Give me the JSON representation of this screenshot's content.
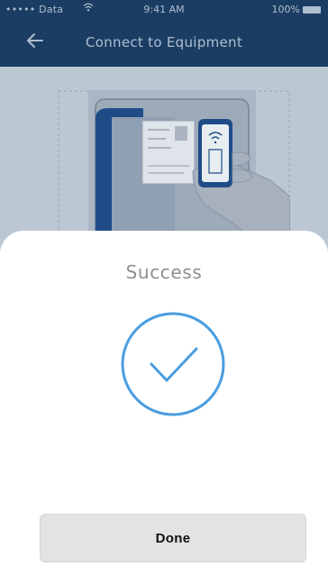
{
  "status_bar": {
    "carrier": "••••• Data",
    "time": "9:41 AM",
    "battery": "100%"
  },
  "nav": {
    "title": "Connect to Equipment",
    "back_icon": "arrow-left-icon"
  },
  "modal": {
    "title": "Success",
    "icon": "checkmark-circle-icon",
    "done_label": "Done"
  },
  "colors": {
    "nav_bg": "#1c3d63",
    "success_blue": "#4a9de0",
    "button_bg": "#e3e3e5"
  }
}
